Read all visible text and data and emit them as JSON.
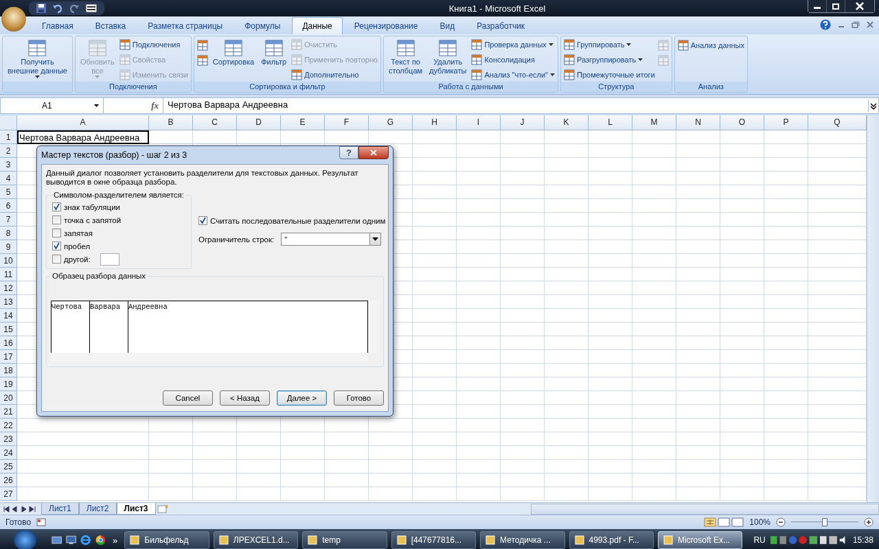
{
  "window": {
    "title": "Книга1 - Microsoft Excel"
  },
  "tabs": [
    {
      "label": "Главная",
      "selected": false
    },
    {
      "label": "Вставка",
      "selected": false
    },
    {
      "label": "Разметка страницы",
      "selected": false
    },
    {
      "label": "Формулы",
      "selected": false
    },
    {
      "label": "Данные",
      "selected": true
    },
    {
      "label": "Рецензирование",
      "selected": false
    },
    {
      "label": "Вид",
      "selected": false
    },
    {
      "label": "Разработчик",
      "selected": false
    }
  ],
  "ribbon": {
    "groups": [
      {
        "columns": [
          {
            "kind": "large",
            "items": [
              {
                "label": "Получить\nвнешние данные",
                "disabled": false,
                "dropdown": true
              }
            ]
          }
        ]
      },
      {
        "title": "Подключения",
        "columns": [
          {
            "kind": "large",
            "items": [
              {
                "label": "Обновить\nвсе",
                "disabled": true,
                "dropdown": true
              }
            ]
          },
          {
            "kind": "stack",
            "items": [
              {
                "label": "Подключения",
                "disabled": false,
                "dropdown": false
              },
              {
                "label": "Свойства",
                "disabled": true,
                "dropdown": false
              },
              {
                "label": "Изменить связи",
                "disabled": true,
                "dropdown": false
              }
            ]
          }
        ]
      },
      {
        "title": "Сортировка и фильтр",
        "columns": [
          {
            "kind": "stack",
            "items": [
              {
                "disabled": false,
                "dropdown": false
              },
              {
                "disabled": false,
                "dropdown": false
              }
            ]
          },
          {
            "kind": "large",
            "items": [
              {
                "label": "Сортировка",
                "disabled": false,
                "dropdown": false
              }
            ]
          },
          {
            "kind": "large",
            "items": [
              {
                "label": "Фильтр",
                "disabled": false,
                "dropdown": false
              }
            ]
          },
          {
            "kind": "stack",
            "items": [
              {
                "label": "Очистить",
                "disabled": true,
                "dropdown": false
              },
              {
                "label": "Применить повторно",
                "disabled": true,
                "dropdown": false
              },
              {
                "label": "Дополнительно",
                "disabled": false,
                "dropdown": false
              }
            ]
          }
        ]
      },
      {
        "title": "Работа с данными",
        "columns": [
          {
            "kind": "large",
            "items": [
              {
                "label": "Текст по\nстолбцам",
                "disabled": false,
                "dropdown": false
              }
            ]
          },
          {
            "kind": "large",
            "items": [
              {
                "label": "Удалить\nдубликаты",
                "disabled": false,
                "dropdown": false
              }
            ]
          },
          {
            "kind": "stack",
            "items": [
              {
                "label": "Проверка данных",
                "disabled": false,
                "dropdown": true
              },
              {
                "label": "Консолидация",
                "disabled": false,
                "dropdown": false
              },
              {
                "label": "Анализ \"что-если\"",
                "disabled": false,
                "dropdown": true
              }
            ]
          }
        ]
      },
      {
        "title": "Структура",
        "columns": [
          {
            "kind": "stack",
            "items": [
              {
                "label": "Группировать",
                "disabled": false,
                "dropdown": true
              },
              {
                "label": "Разгруппировать",
                "disabled": false,
                "dropdown": true
              },
              {
                "label": "Промежуточные итоги",
                "disabled": false,
                "dropdown": false
              }
            ]
          },
          {
            "kind": "stack",
            "items": [
              {
                "disabled": true,
                "dropdown": false
              },
              {
                "disabled": true,
                "dropdown": false
              }
            ]
          }
        ]
      },
      {
        "title": "Анализ",
        "columns": [
          {
            "kind": "stack",
            "items": [
              {
                "label": "Анализ данных",
                "disabled": false,
                "dropdown": false
              }
            ]
          }
        ]
      }
    ]
  },
  "formula_bar": {
    "name_box": "A1",
    "fx": "fx",
    "value": "Чертова Варвара Андреевна"
  },
  "sheet": {
    "columns": [
      "A",
      "B",
      "C",
      "D",
      "E",
      "F",
      "G",
      "H",
      "I",
      "J",
      "K",
      "L",
      "M",
      "N",
      "O",
      "P",
      "Q"
    ],
    "rows": [
      "1",
      "2",
      "3",
      "4",
      "5",
      "6",
      "7",
      "8",
      "9",
      "10",
      "11",
      "12",
      "13",
      "14",
      "15",
      "16",
      "17",
      "18",
      "19",
      "20",
      "21",
      "22",
      "23",
      "24",
      "25",
      "26",
      "27"
    ],
    "cell_a1": "Чертова Варвара Андреевна"
  },
  "sheet_tabs": [
    {
      "label": "Лист1",
      "selected": false
    },
    {
      "label": "Лист2",
      "selected": false
    },
    {
      "label": "Лист3",
      "selected": true
    }
  ],
  "status_bar": {
    "text": "Готово",
    "zoom": "100%",
    "zoom_slider": {
      "level": 0.5
    }
  },
  "dialog": {
    "title": "Мастер текстов (разбор) - шаг 2 из 3",
    "help": "?",
    "description": "Данный диалог позволяет установить разделители для текстовых данных. Результат выводится в окне образца разбора.",
    "delimiters_title": "Символом-разделителем является:",
    "delimiters": [
      {
        "label": "знак табуляции",
        "checked": true,
        "kind": "plain"
      },
      {
        "label": "точка с запятой",
        "checked": false,
        "kind": "plain"
      },
      {
        "label": "запятая",
        "checked": false,
        "kind": "plain"
      },
      {
        "label": "пробел",
        "checked": true,
        "kind": "plain"
      },
      {
        "label": "другой:",
        "checked": false,
        "kind": "other"
      }
    ],
    "consecutive": {
      "label": "Считать последовательные разделители одним",
      "checked": true
    },
    "qualifier": {
      "label": "Ограничитель строк:",
      "value": "\""
    },
    "preview_title": "Образец разбора данных",
    "preview_columns": [
      "Чертова",
      "Варвара",
      "Андреевна"
    ],
    "buttons": [
      {
        "label": "Cancel",
        "default": false
      },
      {
        "label": "< Назад",
        "default": false
      },
      {
        "label": "Далее >",
        "default": true
      },
      {
        "label": "Готово",
        "default": false
      }
    ]
  },
  "taskbar": {
    "more": "»",
    "items": [
      {
        "label": "Бильфельд",
        "selected": false
      },
      {
        "label": "ЛРEXCEL1.d...",
        "selected": false
      },
      {
        "label": "temp",
        "selected": false
      },
      {
        "label": "[447677816...",
        "selected": false
      },
      {
        "label": "Методичка ...",
        "selected": false
      },
      {
        "label": "4993.pdf - F...",
        "selected": false
      },
      {
        "label": "Microsoft Ex...",
        "selected": true
      }
    ],
    "language": "RU",
    "time": "15:38"
  }
}
